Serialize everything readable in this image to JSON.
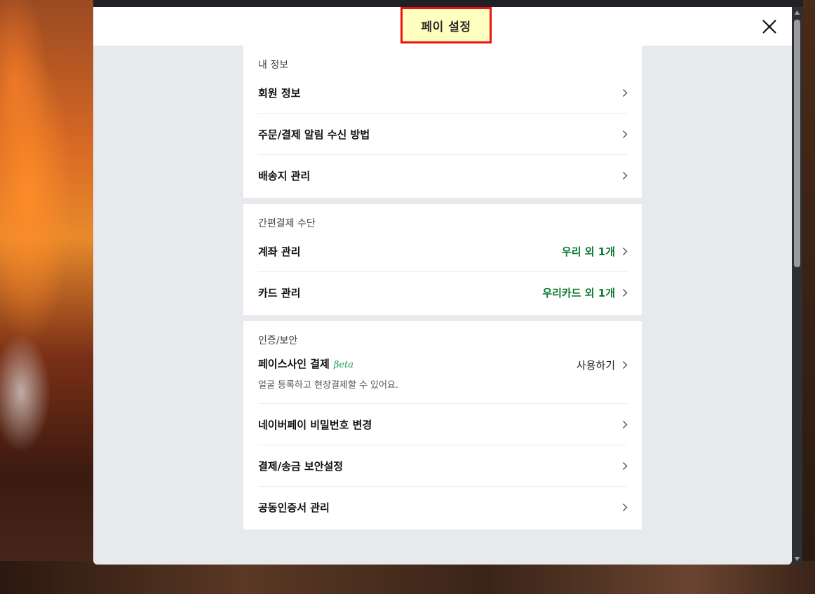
{
  "modal": {
    "title": "페이 설정",
    "close_icon": "close-icon"
  },
  "sections": {
    "my_info": {
      "title": "내 정보",
      "items": [
        {
          "label": "회원 정보"
        },
        {
          "label": "주문/결제 알림 수신 방법"
        },
        {
          "label": "배송지 관리"
        }
      ]
    },
    "payment_methods": {
      "title": "간편결제 수단",
      "items": [
        {
          "label": "계좌 관리",
          "value": "우리 외 1개"
        },
        {
          "label": "카드 관리",
          "value": "우리카드 외 1개"
        }
      ]
    },
    "security": {
      "title": "인증/보안",
      "faceid": {
        "label": "페이스사인 결제",
        "badge": "βeta",
        "desc": "얼굴 등록하고 현장결제할 수 있어요.",
        "action": "사용하기"
      },
      "items": [
        {
          "label": "네이버페이 비밀번호 변경"
        },
        {
          "label": "결제/송금 보안설정"
        },
        {
          "label": "공동인증서 관리"
        }
      ]
    }
  },
  "colors": {
    "value_green": "#0f7a32",
    "beta_green": "#14a050",
    "highlight_border": "#ee1111",
    "highlight_fill": "#ffffc0"
  },
  "scrollbar": {
    "position": 0.0
  }
}
